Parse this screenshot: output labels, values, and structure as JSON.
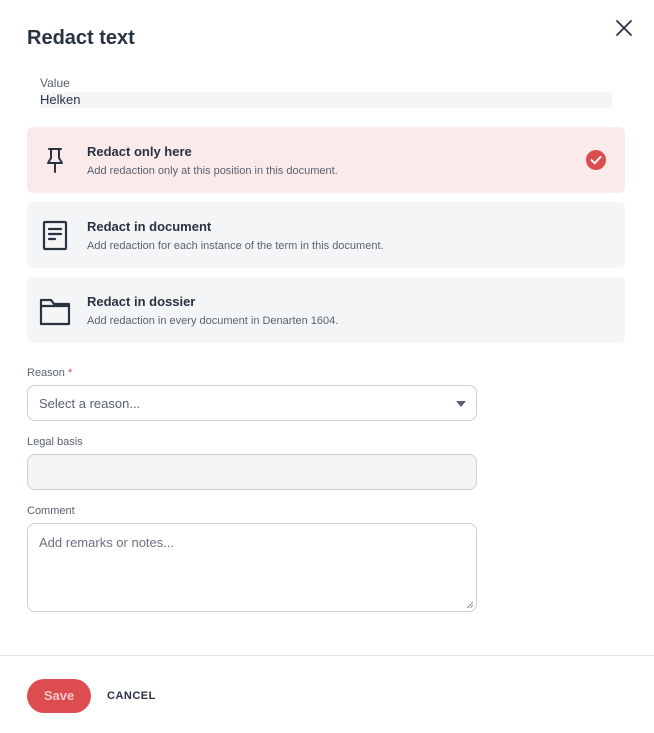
{
  "dialog": {
    "title": "Redact text",
    "close_icon": "close-icon"
  },
  "value": {
    "label": "Value",
    "text": "Helken"
  },
  "options": [
    {
      "title": "Redact only here",
      "description": "Add redaction only at this position in this document.",
      "icon": "pin-icon",
      "selected": true
    },
    {
      "title": "Redact in document",
      "description": "Add redaction for each instance of the term in this document.",
      "icon": "document-icon",
      "selected": false
    },
    {
      "title": "Redact in dossier",
      "description": "Add redaction in every document in Denarten 1604.",
      "icon": "folder-icon",
      "selected": false
    }
  ],
  "form": {
    "reason_label": "Reason",
    "reason_required_mark": "*",
    "reason_placeholder": "Select a reason...",
    "legal_basis_label": "Legal basis",
    "legal_basis_value": "",
    "comment_label": "Comment",
    "comment_placeholder": "Add remarks or notes..."
  },
  "footer": {
    "save_label": "Save",
    "cancel_label": "CANCEL"
  },
  "colors": {
    "accent": "#dd4d50",
    "selected_bg": "#fbeaea",
    "option_bg": "#f4f5f7",
    "text": "#283241"
  }
}
